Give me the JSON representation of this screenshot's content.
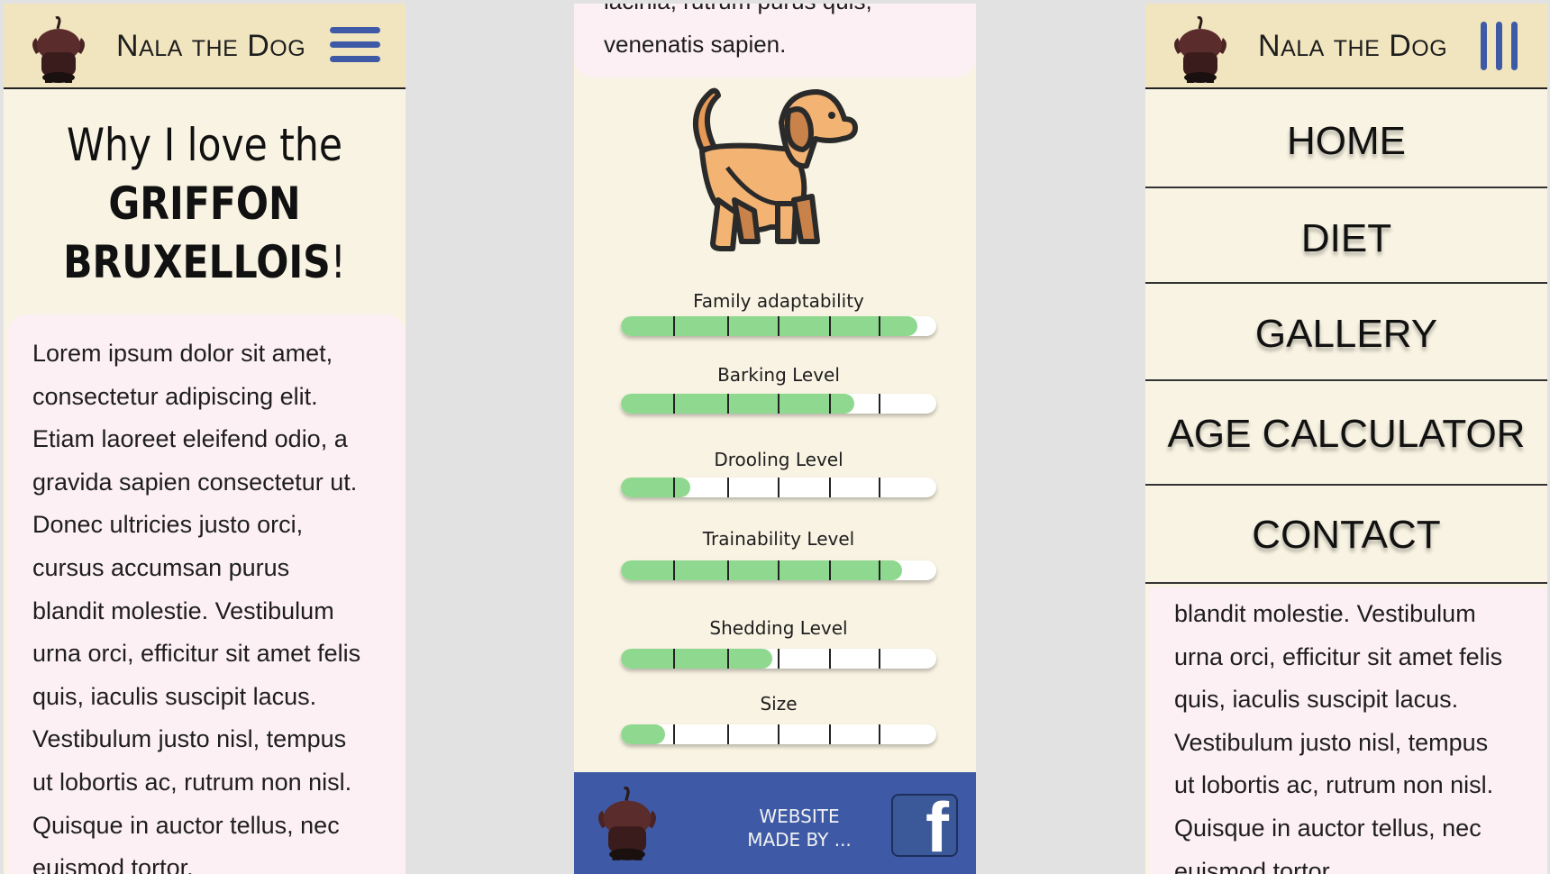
{
  "header": {
    "brand_first": "N",
    "brand_first_rest": "ALA",
    "brand_the": "THE",
    "brand_d": "D",
    "brand_d_rest": "OG"
  },
  "hero": {
    "line1": "Why I love the",
    "line2": "GRIFFON",
    "line3a": "BRUXELLOIS",
    "line3b": "!"
  },
  "lorem_lines": [
    "Lorem ipsum dolor sit amet,",
    "consectetur adipiscing elit.",
    "Etiam laoreet eleifend odio, a",
    "gravida sapien consectetur ut.",
    "Donec ultricies justo orci,",
    "cursus accumsan purus",
    "blandit molestie. Vestibulum",
    "urna orci, efficitur sit amet felis",
    "quis, iaculis suscipit lacus.",
    "Vestibulum justo nisl, tempus",
    "ut lobortis ac, rutrum non nisl.",
    "Quisque in auctor tellus, nec",
    "euismod tortor."
  ],
  "panel2_top": {
    "clipped_line": "lacinia, rutrum purus quis,",
    "line": "venenatis sapien."
  },
  "ratings": [
    {
      "label": "Family adaptability",
      "value": 0.94
    },
    {
      "label": "Barking Level",
      "value": 0.74
    },
    {
      "label": "Drooling Level",
      "value": 0.22
    },
    {
      "label": "Trainability Level",
      "value": 0.89
    },
    {
      "label": "Shedding Level",
      "value": 0.48
    },
    {
      "label": "Size",
      "value": 0.14
    }
  ],
  "footer": {
    "made_line1": "WEBSITE",
    "made_line2": "MADE BY ...",
    "facebook_glyph": "f"
  },
  "menu": {
    "home": "HOME",
    "diet": "DIET",
    "gallery": "GALLERY",
    "age_calculator": "AGE CALCULATOR",
    "contact": "CONTACT"
  },
  "panel3_lines": [
    "blandit molestie. Vestibulum",
    "urna orci, efficitur sit amet felis",
    "quis, iaculis suscipit lacus.",
    "Vestibulum justo nisl, tempus",
    "ut lobortis ac, rutrum non nisl.",
    "Quisque in auctor tellus, nec",
    "euismod tortor."
  ],
  "colors": {
    "header_bg": "#f1e5bf",
    "page_bg": "#f8f3e2",
    "card_bg": "#fdf0f4",
    "accent_blue": "#3e5aa6",
    "bar_fill": "#8fd88f"
  },
  "icons": {
    "logo": "dog-silhouette-icon",
    "menu": "hamburger-icon",
    "menu_open": "vertical-bars-icon",
    "facebook": "facebook-icon",
    "illustration": "dog-illustration"
  }
}
